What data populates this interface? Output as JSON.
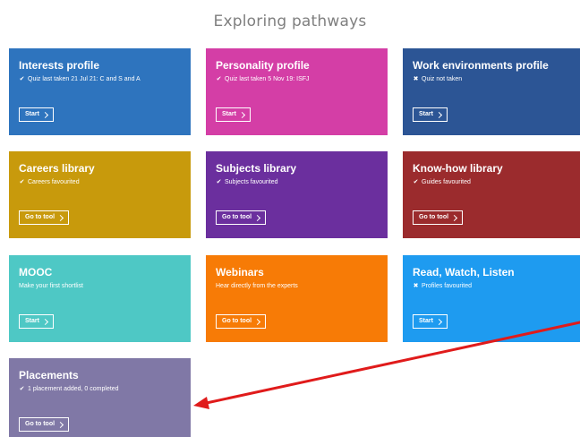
{
  "page": {
    "title": "Exploring pathways"
  },
  "colors": {
    "interests": "#2e74be",
    "personality": "#d43ea6",
    "work_environments": "#2c5595",
    "careers": "#c89a0c",
    "subjects": "#6b2f9e",
    "knowhow": "#9b2b2d",
    "mooc": "#4ec8c5",
    "webinars": "#f77b06",
    "read_watch_listen": "#1e9bf0",
    "placements": "#8078a6",
    "arrow": "#e01b1b"
  },
  "tiles": [
    {
      "title": "Interests profile",
      "status": "Quiz last taken 21 Jul 21: C and S and A",
      "status_icon": "check-icon",
      "button": "Start"
    },
    {
      "title": "Personality profile",
      "status": "Quiz last taken 5 Nov 19: ISFJ",
      "status_icon": "check-icon",
      "button": "Start"
    },
    {
      "title": "Work environments profile",
      "status": "Quiz not taken",
      "status_icon": "cross-icon",
      "button": "Start"
    },
    {
      "title": "Careers library",
      "status": "Careers favourited",
      "status_icon": "check-icon",
      "button": "Go to tool"
    },
    {
      "title": "Subjects library",
      "status": "Subjects favourited",
      "status_icon": "check-icon",
      "button": "Go to tool"
    },
    {
      "title": "Know-how library",
      "status": "Guides favourited",
      "status_icon": "check-icon",
      "button": "Go to tool"
    },
    {
      "title": "MOOC",
      "status": "Make your first shortlist",
      "status_icon": "",
      "button": "Start"
    },
    {
      "title": "Webinars",
      "status": "Hear directly from the experts",
      "status_icon": "",
      "button": "Go to tool"
    },
    {
      "title": "Read, Watch, Listen",
      "status": "Profiles favourited",
      "status_icon": "cross-icon",
      "button": "Start"
    },
    {
      "title": "Placements",
      "status": "1 placement added, 0 completed",
      "status_icon": "check-icon",
      "button": "Go to tool"
    }
  ]
}
